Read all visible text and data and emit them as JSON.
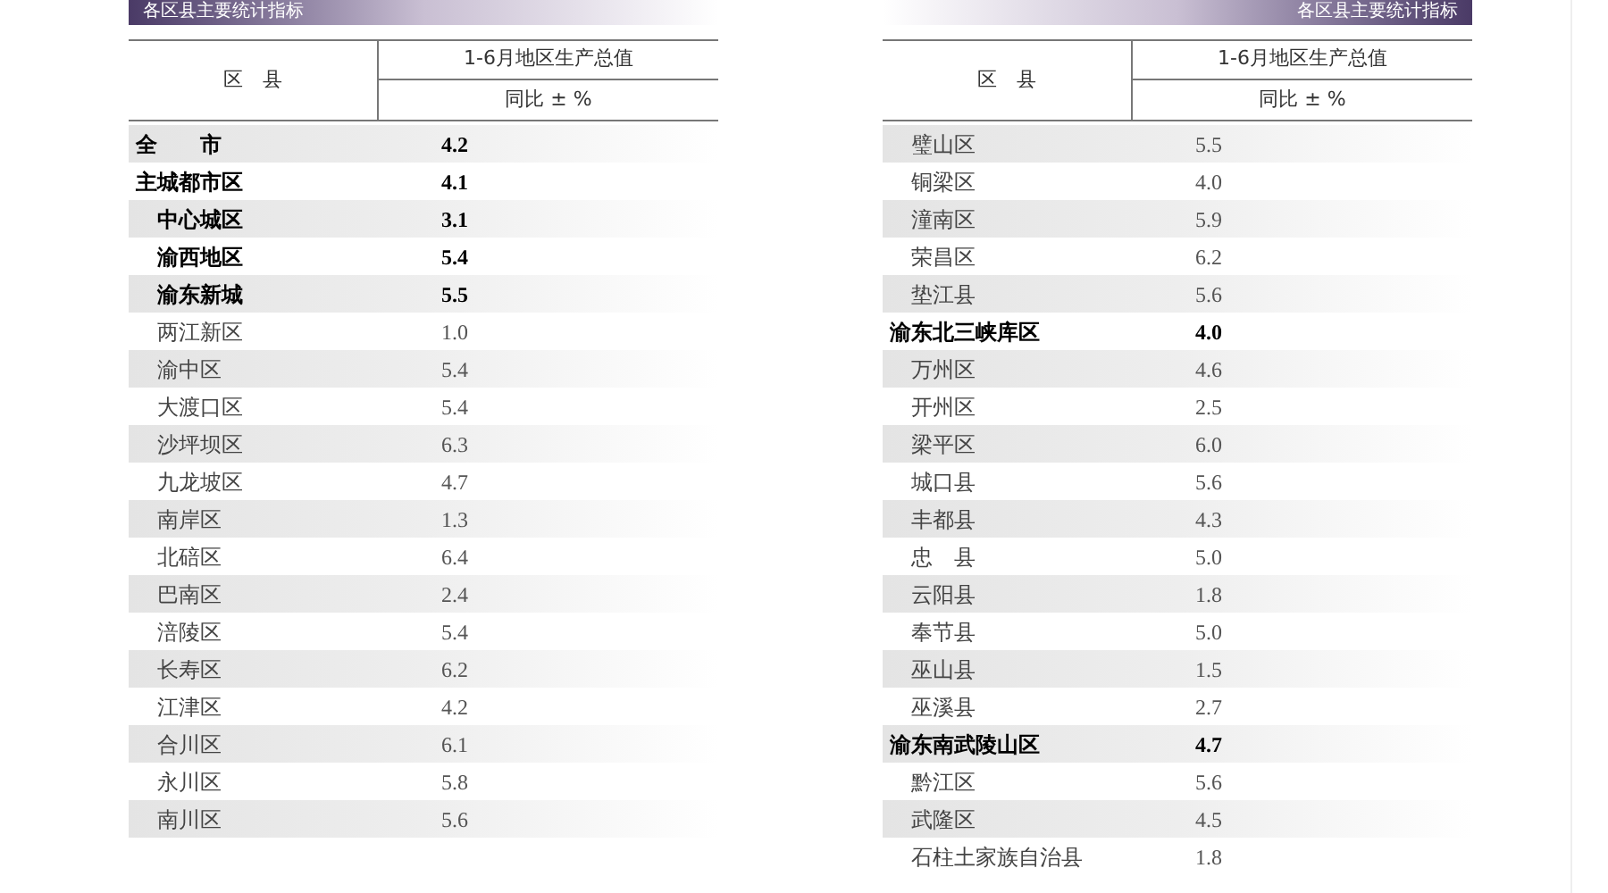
{
  "panels": [
    {
      "banner": "各区县主要统计指标",
      "header": {
        "district": "区　县",
        "indicator": "1-6月地区生产总值",
        "unit": "同比 ± %"
      },
      "rows": [
        {
          "name": "全　　市",
          "value": "4.2",
          "kind": "region"
        },
        {
          "name": "主城都市区",
          "value": "4.1",
          "kind": "region"
        },
        {
          "name": "中心城区",
          "value": "3.1",
          "kind": "subregion"
        },
        {
          "name": "渝西地区",
          "value": "5.4",
          "kind": "subregion"
        },
        {
          "name": "渝东新城",
          "value": "5.5",
          "kind": "subregion"
        },
        {
          "name": "两江新区",
          "value": "1.0",
          "kind": "district"
        },
        {
          "name": "渝中区",
          "value": "5.4",
          "kind": "district"
        },
        {
          "name": "大渡口区",
          "value": "5.4",
          "kind": "district"
        },
        {
          "name": "沙坪坝区",
          "value": "6.3",
          "kind": "district"
        },
        {
          "name": "九龙坡区",
          "value": "4.7",
          "kind": "district"
        },
        {
          "name": "南岸区",
          "value": "1.3",
          "kind": "district"
        },
        {
          "name": "北碚区",
          "value": "6.4",
          "kind": "district"
        },
        {
          "name": "巴南区",
          "value": "2.4",
          "kind": "district"
        },
        {
          "name": "涪陵区",
          "value": "5.4",
          "kind": "district"
        },
        {
          "name": "长寿区",
          "value": "6.2",
          "kind": "district"
        },
        {
          "name": "江津区",
          "value": "4.2",
          "kind": "district"
        },
        {
          "name": "合川区",
          "value": "6.1",
          "kind": "district"
        },
        {
          "name": "永川区",
          "value": "5.8",
          "kind": "district"
        },
        {
          "name": "南川区",
          "value": "5.6",
          "kind": "district"
        }
      ]
    },
    {
      "banner": "各区县主要统计指标",
      "header": {
        "district": "区　县",
        "indicator": "1-6月地区生产总值",
        "unit": "同比 ± %"
      },
      "rows": [
        {
          "name": "璧山区",
          "value": "5.5",
          "kind": "district"
        },
        {
          "name": "铜梁区",
          "value": "4.0",
          "kind": "district"
        },
        {
          "name": "潼南区",
          "value": "5.9",
          "kind": "district"
        },
        {
          "name": "荣昌区",
          "value": "6.2",
          "kind": "district"
        },
        {
          "name": "垫江县",
          "value": "5.6",
          "kind": "district"
        },
        {
          "name": "渝东北三峡库区",
          "value": "4.0",
          "kind": "region"
        },
        {
          "name": "万州区",
          "value": "4.6",
          "kind": "district"
        },
        {
          "name": "开州区",
          "value": "2.5",
          "kind": "district"
        },
        {
          "name": "梁平区",
          "value": "6.0",
          "kind": "district"
        },
        {
          "name": "城口县",
          "value": "5.6",
          "kind": "district"
        },
        {
          "name": "丰都县",
          "value": "4.3",
          "kind": "district"
        },
        {
          "name": "忠　县",
          "value": "5.0",
          "kind": "district"
        },
        {
          "name": "云阳县",
          "value": "1.8",
          "kind": "district"
        },
        {
          "name": "奉节县",
          "value": "5.0",
          "kind": "district"
        },
        {
          "name": "巫山县",
          "value": "1.5",
          "kind": "district"
        },
        {
          "name": "巫溪县",
          "value": "2.7",
          "kind": "district"
        },
        {
          "name": "渝东南武陵山区",
          "value": "4.7",
          "kind": "region"
        },
        {
          "name": "黔江区",
          "value": "5.6",
          "kind": "district"
        },
        {
          "name": "武隆区",
          "value": "4.5",
          "kind": "district"
        },
        {
          "name": "石柱土家族自治县",
          "value": "1.8",
          "kind": "district"
        }
      ]
    }
  ]
}
